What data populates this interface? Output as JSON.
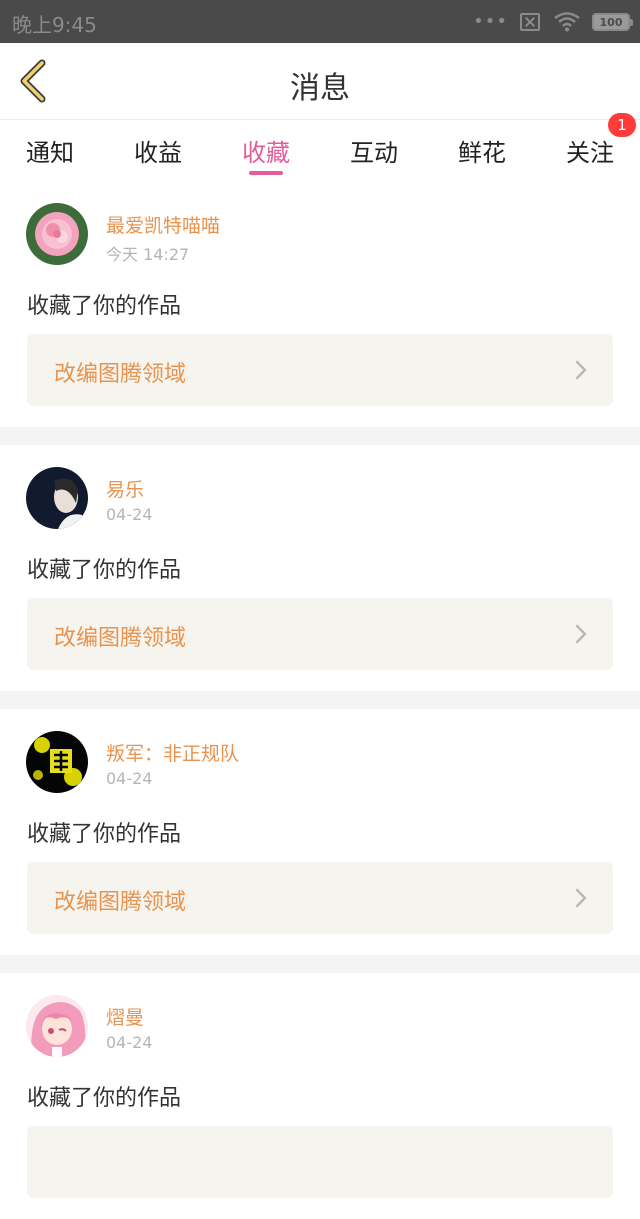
{
  "status_bar": {
    "time": "晚上9:45",
    "battery": "100",
    "icons": [
      "more-dots-icon",
      "no-sim-icon",
      "wifi-icon",
      "battery-icon"
    ]
  },
  "header": {
    "title": "消息",
    "back_icon": "back-chevron-icon"
  },
  "tabs": [
    {
      "label": "通知"
    },
    {
      "label": "收益"
    },
    {
      "label": "收藏",
      "active": true
    },
    {
      "label": "互动"
    },
    {
      "label": "鲜花"
    },
    {
      "label": "关注",
      "badge": "1"
    }
  ],
  "colors": {
    "accent": "#e35d9a",
    "name": "#e8934f",
    "badge": "#ff3b3b",
    "card_bg": "#f5f4ee"
  },
  "messages": [
    {
      "user": "最爱凯特喵喵",
      "time": "今天 14:27",
      "action": "收藏了你的作品",
      "work": "改编图腾领域"
    },
    {
      "user": "易乐",
      "time": "04-24",
      "action": "收藏了你的作品",
      "work": "改编图腾领域"
    },
    {
      "user": "叛军：非正规队",
      "time": "04-24",
      "action": "收藏了你的作品",
      "work": "改编图腾领域"
    },
    {
      "user": "熠曼",
      "time": "04-24",
      "action": "收藏了你的作品",
      "work": ""
    }
  ]
}
